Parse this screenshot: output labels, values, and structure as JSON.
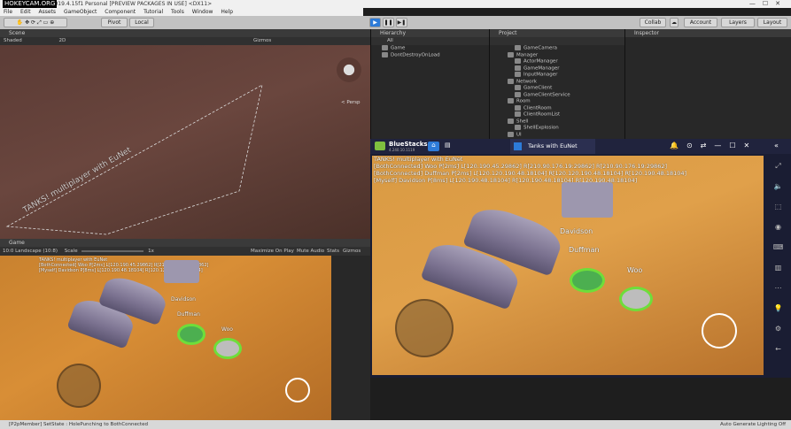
{
  "window": {
    "title": "Unity 2019.4.15f1 Personal [PREVIEW PACKAGES IN USE] <DX11>",
    "watermark": "HOKEYCAM.ORG"
  },
  "menu": [
    "File",
    "Edit",
    "Assets",
    "GameObject",
    "Component",
    "Tutorial",
    "Tools",
    "Window",
    "Help"
  ],
  "toolbar": {
    "pivot": "Pivot",
    "local": "Local",
    "collab": "Collab",
    "account": "Account",
    "layers": "Layers",
    "layout": "Layout"
  },
  "scene": {
    "tab": "Scene",
    "shading": "Shaded",
    "mode": "2D",
    "gizmos": "Gizmos",
    "persp": "< Persp",
    "overlay_text": "TANKS! multiplayer with EuNet"
  },
  "game": {
    "tab": "Game",
    "resolution": "10:0 Landscape (10:8)",
    "scale_label": "Scale",
    "scale_value": "1x",
    "maximize": "Maximize On Play",
    "mute": "Mute Audio",
    "stats": "Stats",
    "gizmos": "Gizmos",
    "overlay": [
      "TANKS! multiplayer with EuNet",
      "[BothConnected] Woo P[2ms] L[120.190.45.29862] R[210.90.176.19:29862]",
      "[Myself] Davidson P[8ms] L[120.190.48.18104] R[120.120.190.48.18104]"
    ],
    "names": [
      "Davidson",
      "Duffman",
      "Woo"
    ]
  },
  "hierarchy": {
    "tab": "Hierarchy",
    "search": "All",
    "items": [
      "Game",
      "DontDestroyOnLoad"
    ]
  },
  "project": {
    "tab": "Project",
    "items": [
      "GameCamera",
      "Manager",
      "ActorManager",
      "GameManager",
      "InputManager",
      "Network",
      "GameClient",
      "GameClientService",
      "Room",
      "ClientRoom",
      "ClientRoomList",
      "Shell",
      "ShellExplosion",
      "UI"
    ]
  },
  "inspector": {
    "tab": "Inspector"
  },
  "bluestacks": {
    "brand": "BlueStacks",
    "version": "4.240.10.1119",
    "tab_title": "Tanks with EuNet",
    "overlay": [
      "TANKS! multiplayer with EuNet",
      "[BothConnected] Woo P[2ms] L[120.190.45.29862] R[210.90.176.19:29862] R[210.90.176.19:29862]",
      "[BothConnected] Duffman P[2ms] L[120.120.190.48.18104] R[120.120.190.48.18104] R[120.190.48.18104]",
      "[Myself] Davidson P[8ms] L[120.190.48.18104] R[120.190.48.18104] R[120.190.48.18104]"
    ],
    "names": [
      "Davidson",
      "Duffman",
      "Woo"
    ]
  },
  "status": {
    "left": "[P2pMember] SetState : HolePunching to BothConnected",
    "right": "Auto Generate Lighting Off"
  },
  "colors": {
    "accent": "#2d7bd8",
    "bs_bg": "#1a1d33",
    "sand": "#d99a43"
  }
}
